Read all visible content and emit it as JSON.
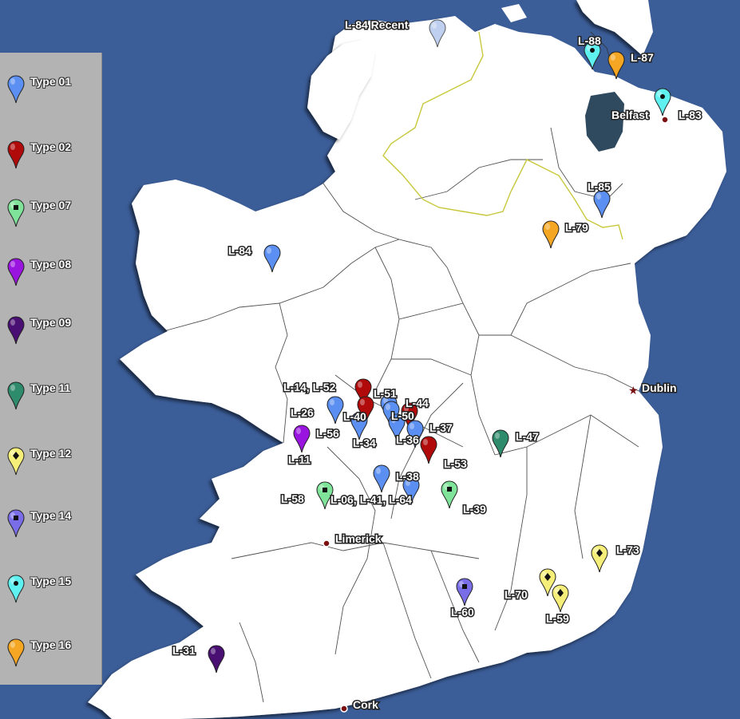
{
  "legend": [
    {
      "label": "Type 01",
      "color": "#5b8ff2",
      "center": "none"
    },
    {
      "label": "Type 02",
      "color": "#b00a0a",
      "center": "none"
    },
    {
      "label": "Type 07",
      "color": "#7fe39a",
      "center": "square"
    },
    {
      "label": "Type 08",
      "color": "#9a14e0",
      "center": "none"
    },
    {
      "label": "Type 09",
      "color": "#4a0f73",
      "center": "none"
    },
    {
      "label": "Type 11",
      "color": "#2e8b6b",
      "center": "none"
    },
    {
      "label": "Type 12",
      "color": "#f5ef7a",
      "center": "diamond"
    },
    {
      "label": "Type 14",
      "color": "#7a6ee8",
      "center": "square"
    },
    {
      "label": "Type 15",
      "color": "#5ff0f0",
      "center": "dot"
    },
    {
      "label": "Type 16",
      "color": "#f5a623",
      "center": "none"
    }
  ],
  "cities": [
    {
      "name": "Belfast",
      "marker": "dot"
    },
    {
      "name": "Dublin",
      "marker": "star"
    },
    {
      "name": "Limerick",
      "marker": "dot"
    },
    {
      "name": "Cork",
      "marker": "dot"
    }
  ],
  "map_labels": [
    "L-84 Recent",
    "L-88",
    "L-87",
    "L-83",
    "L-85",
    "L-79",
    "L-84",
    "L-14, L-52",
    "L-51",
    "L-44",
    "L-26",
    "L-40",
    "L-50",
    "L-56",
    "L-34",
    "L-36",
    "L-37",
    "L-11",
    "L-47",
    "L-53",
    "L-38",
    "L-58",
    "L-06, L-41, L-64",
    "L-39",
    "L-73",
    "L-70",
    "L-59",
    "L-60",
    "L-31"
  ],
  "pins": [
    {
      "label": "L-84 Recent",
      "type": "Type 01 (faded)",
      "color": "#a9c0ec",
      "center": "none"
    },
    {
      "label": "L-88",
      "type": "Type 15",
      "color": "#5ff0f0",
      "center": "dot"
    },
    {
      "label": "L-87",
      "type": "Type 16",
      "color": "#f5a623",
      "center": "none"
    },
    {
      "label": "L-83",
      "type": "Type 15",
      "color": "#5ff0f0",
      "center": "dot"
    },
    {
      "label": "L-85",
      "type": "Type 01",
      "color": "#5b8ff2",
      "center": "none"
    },
    {
      "label": "L-79",
      "type": "Type 16",
      "color": "#f5a623",
      "center": "none"
    },
    {
      "label": "L-84",
      "type": "Type 01",
      "color": "#5b8ff2",
      "center": "none"
    },
    {
      "label": "L-14, L-52",
      "type": "Type 02",
      "color": "#b00a0a",
      "center": "none"
    },
    {
      "label": "L-51",
      "type": "Type 01",
      "color": "#5b8ff2",
      "center": "none"
    },
    {
      "label": "L-44",
      "type": "Type 02",
      "color": "#b00a0a",
      "center": "none"
    },
    {
      "label": "L-26",
      "type": "Type 01",
      "color": "#5b8ff2",
      "center": "none"
    },
    {
      "label": "L-40",
      "type": "Type 02",
      "color": "#b00a0a",
      "center": "none"
    },
    {
      "label": "L-50",
      "type": "Type 01",
      "color": "#5b8ff2",
      "center": "none"
    },
    {
      "label": "L-56",
      "type": "Type 01",
      "color": "#5b8ff2",
      "center": "none"
    },
    {
      "label": "L-34",
      "type": "Type 01",
      "color": "#5b8ff2",
      "center": "none"
    },
    {
      "label": "L-36",
      "type": "Type 01",
      "color": "#5b8ff2",
      "center": "none"
    },
    {
      "label": "L-37",
      "type": "Type 02",
      "color": "#b00a0a",
      "center": "none"
    },
    {
      "label": "L-11",
      "type": "Type 08",
      "color": "#9a14e0",
      "center": "none"
    },
    {
      "label": "L-47",
      "type": "Type 11",
      "color": "#2e8b6b",
      "center": "none"
    },
    {
      "label": "L-38",
      "type": "Type 01",
      "color": "#5b8ff2",
      "center": "none"
    },
    {
      "label": "L-64",
      "type": "Type 01",
      "color": "#5b8ff2",
      "center": "none"
    },
    {
      "label": "L-58",
      "type": "Type 07",
      "color": "#7fe39a",
      "center": "square"
    },
    {
      "label": "L-39",
      "type": "Type 07",
      "color": "#7fe39a",
      "center": "square"
    },
    {
      "label": "L-73",
      "type": "Type 12",
      "color": "#f5ef7a",
      "center": "diamond"
    },
    {
      "label": "L-70",
      "type": "Type 12",
      "color": "#f5ef7a",
      "center": "diamond"
    },
    {
      "label": "L-59",
      "type": "Type 12",
      "color": "#f5ef7a",
      "center": "diamond"
    },
    {
      "label": "L-60",
      "type": "Type 14",
      "color": "#7a6ee8",
      "center": "square"
    },
    {
      "label": "L-31",
      "type": "Type 09",
      "color": "#4a0f73",
      "center": "none"
    }
  ]
}
